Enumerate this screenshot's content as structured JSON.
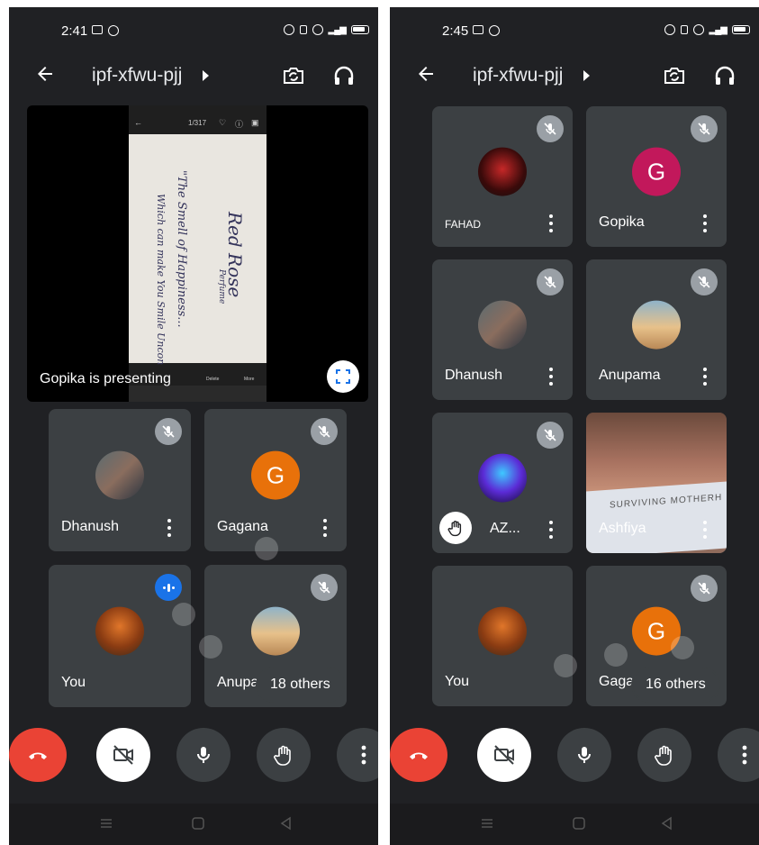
{
  "left": {
    "status": {
      "time": "2:41"
    },
    "meeting_code": "ipf-xfwu-pjj",
    "presenting_label": "Gopika is presenting",
    "shared_screen": {
      "counter": "1/317",
      "line1": "Red Rose",
      "line2": "Perfume",
      "line3": "\"The Smell of Happiness...",
      "line4": "Which can make You Smile Uncon",
      "delete": "Delete",
      "more": "More"
    },
    "tiles": [
      {
        "name": "Dhanush"
      },
      {
        "name": "Gagana",
        "initial": "G"
      },
      {
        "name": "You"
      },
      {
        "name": "Anupama"
      }
    ],
    "others": "18 others"
  },
  "right": {
    "status": {
      "time": "2:45"
    },
    "meeting_code": "ipf-xfwu-pjj",
    "tiles": [
      {
        "name": "FAHAD"
      },
      {
        "name": "Gopika",
        "initial": "G"
      },
      {
        "name": "Dhanush"
      },
      {
        "name": "Anupama"
      },
      {
        "name": "AZ..."
      },
      {
        "name": "Ashfiya",
        "paper_text": "SURVIVING MOTHERH"
      },
      {
        "name": "You"
      },
      {
        "name": "Gagana",
        "initial": "G"
      }
    ],
    "others": "16 others"
  },
  "colors": {
    "background": "#202124",
    "tile": "#3c4043",
    "end_call": "#ea4335",
    "gopika_avatar": "#c2185b",
    "gagana_avatar": "#e8710a",
    "speaking": "#1a73e8"
  }
}
